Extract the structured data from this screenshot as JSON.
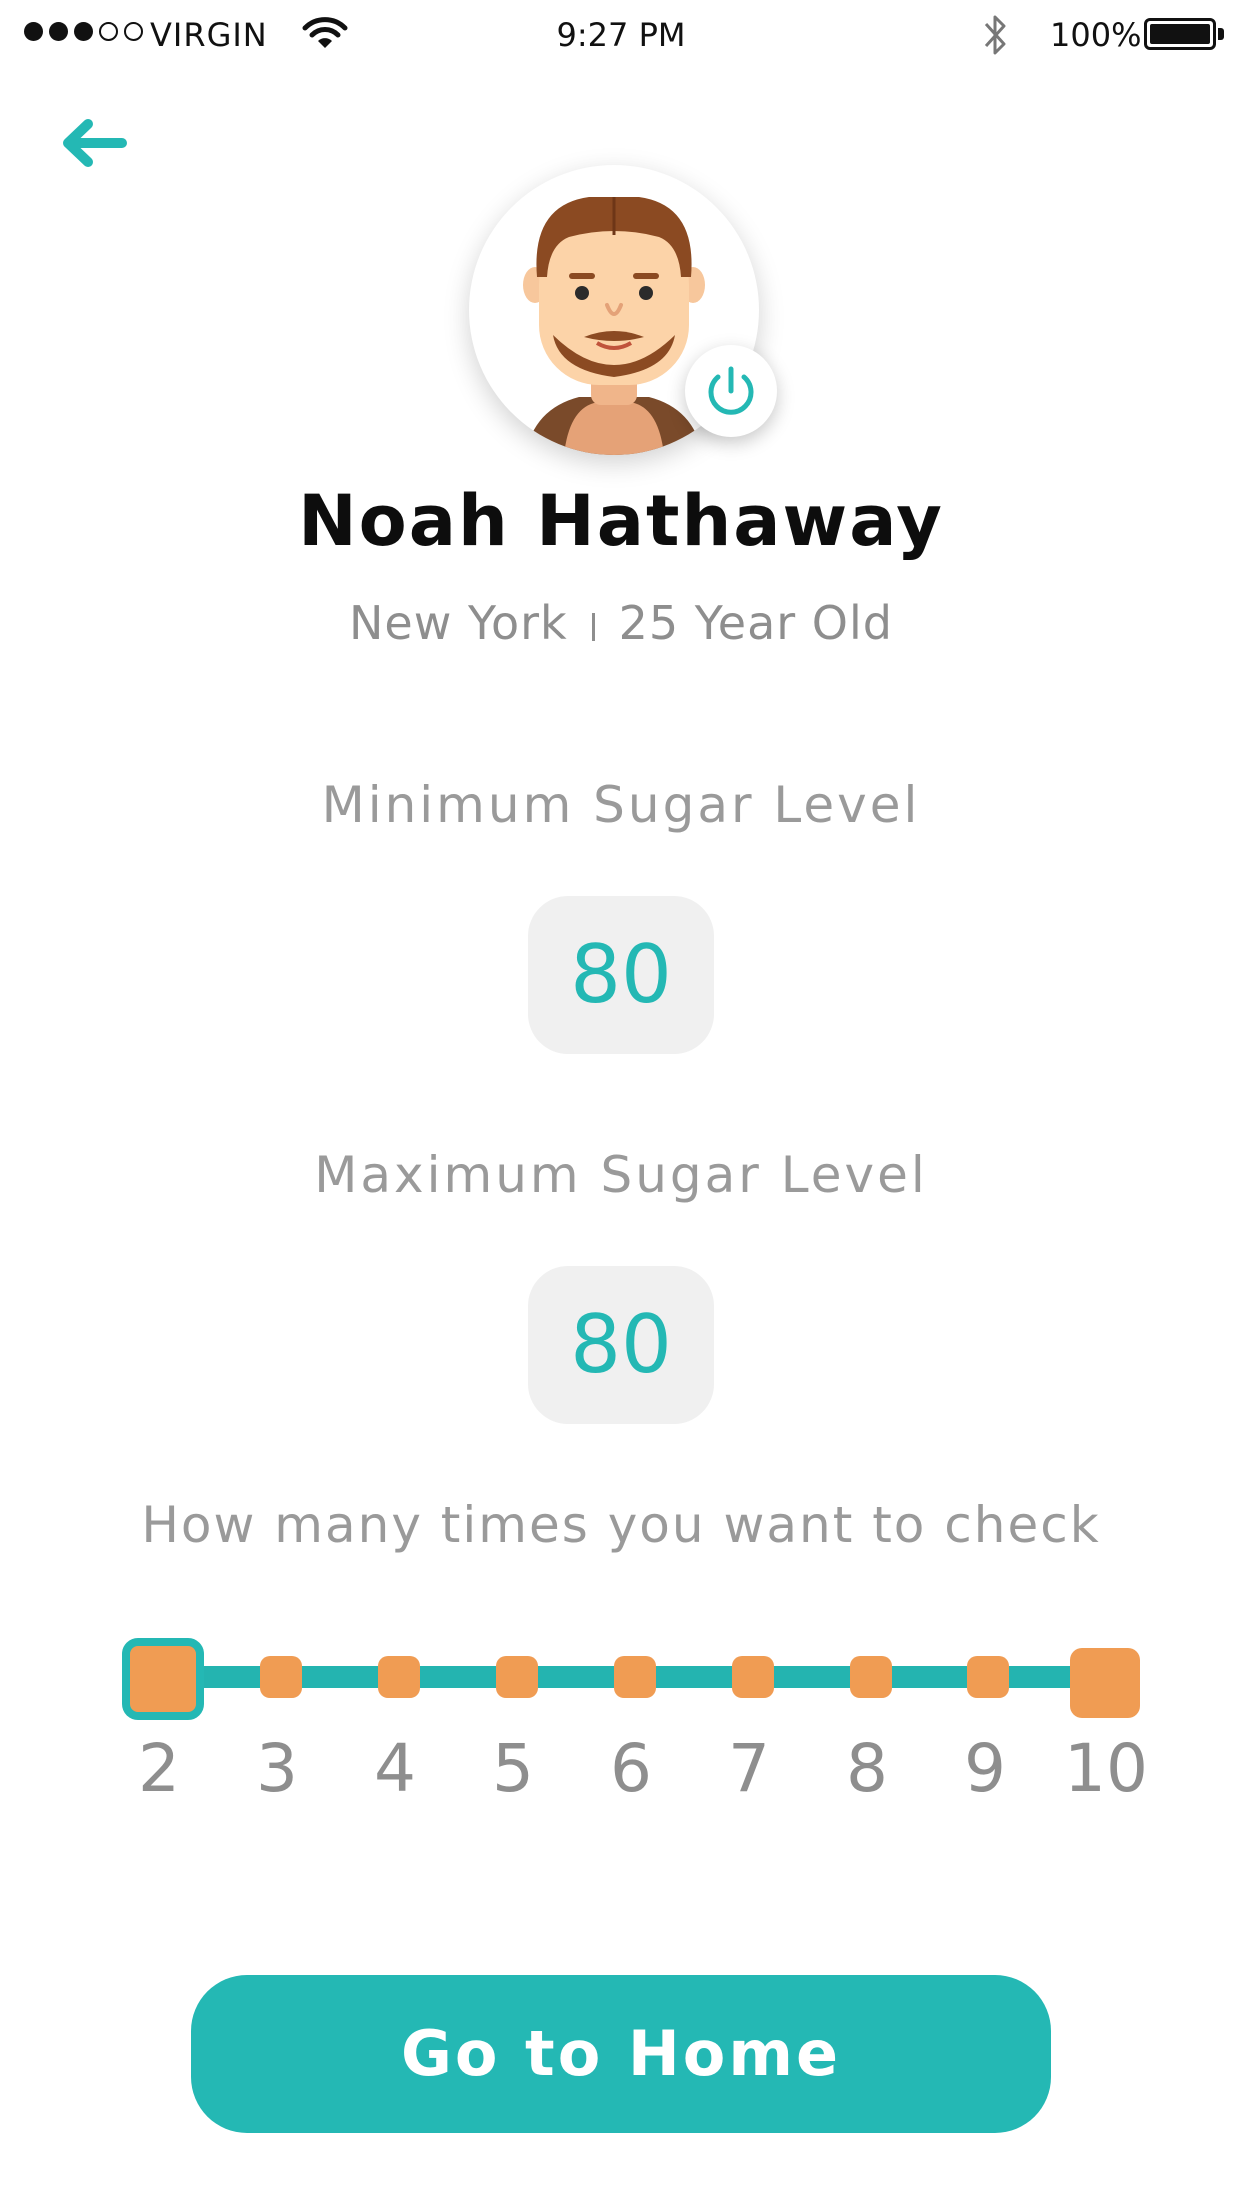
{
  "status_bar": {
    "carrier": "VIRGIN",
    "time": "9:27 PM",
    "battery": "100%",
    "signal_bars": 3,
    "signal_total": 5
  },
  "profile": {
    "name": "Noah Hathaway",
    "city": "New York",
    "age": "25 Year Old"
  },
  "min_sugar": {
    "label": "Minimum Sugar Level",
    "value": "80"
  },
  "max_sugar": {
    "label": "Maximum Sugar Level",
    "value": "80"
  },
  "check": {
    "label": "How many times you want to check",
    "ticks": [
      "2",
      "3",
      "4",
      "5",
      "6",
      "7",
      "8",
      "9",
      "10"
    ],
    "selected": "2"
  },
  "cta": {
    "label": "Go to Home"
  },
  "colors": {
    "accent": "#24b8b4",
    "stop": "#f09c53"
  }
}
